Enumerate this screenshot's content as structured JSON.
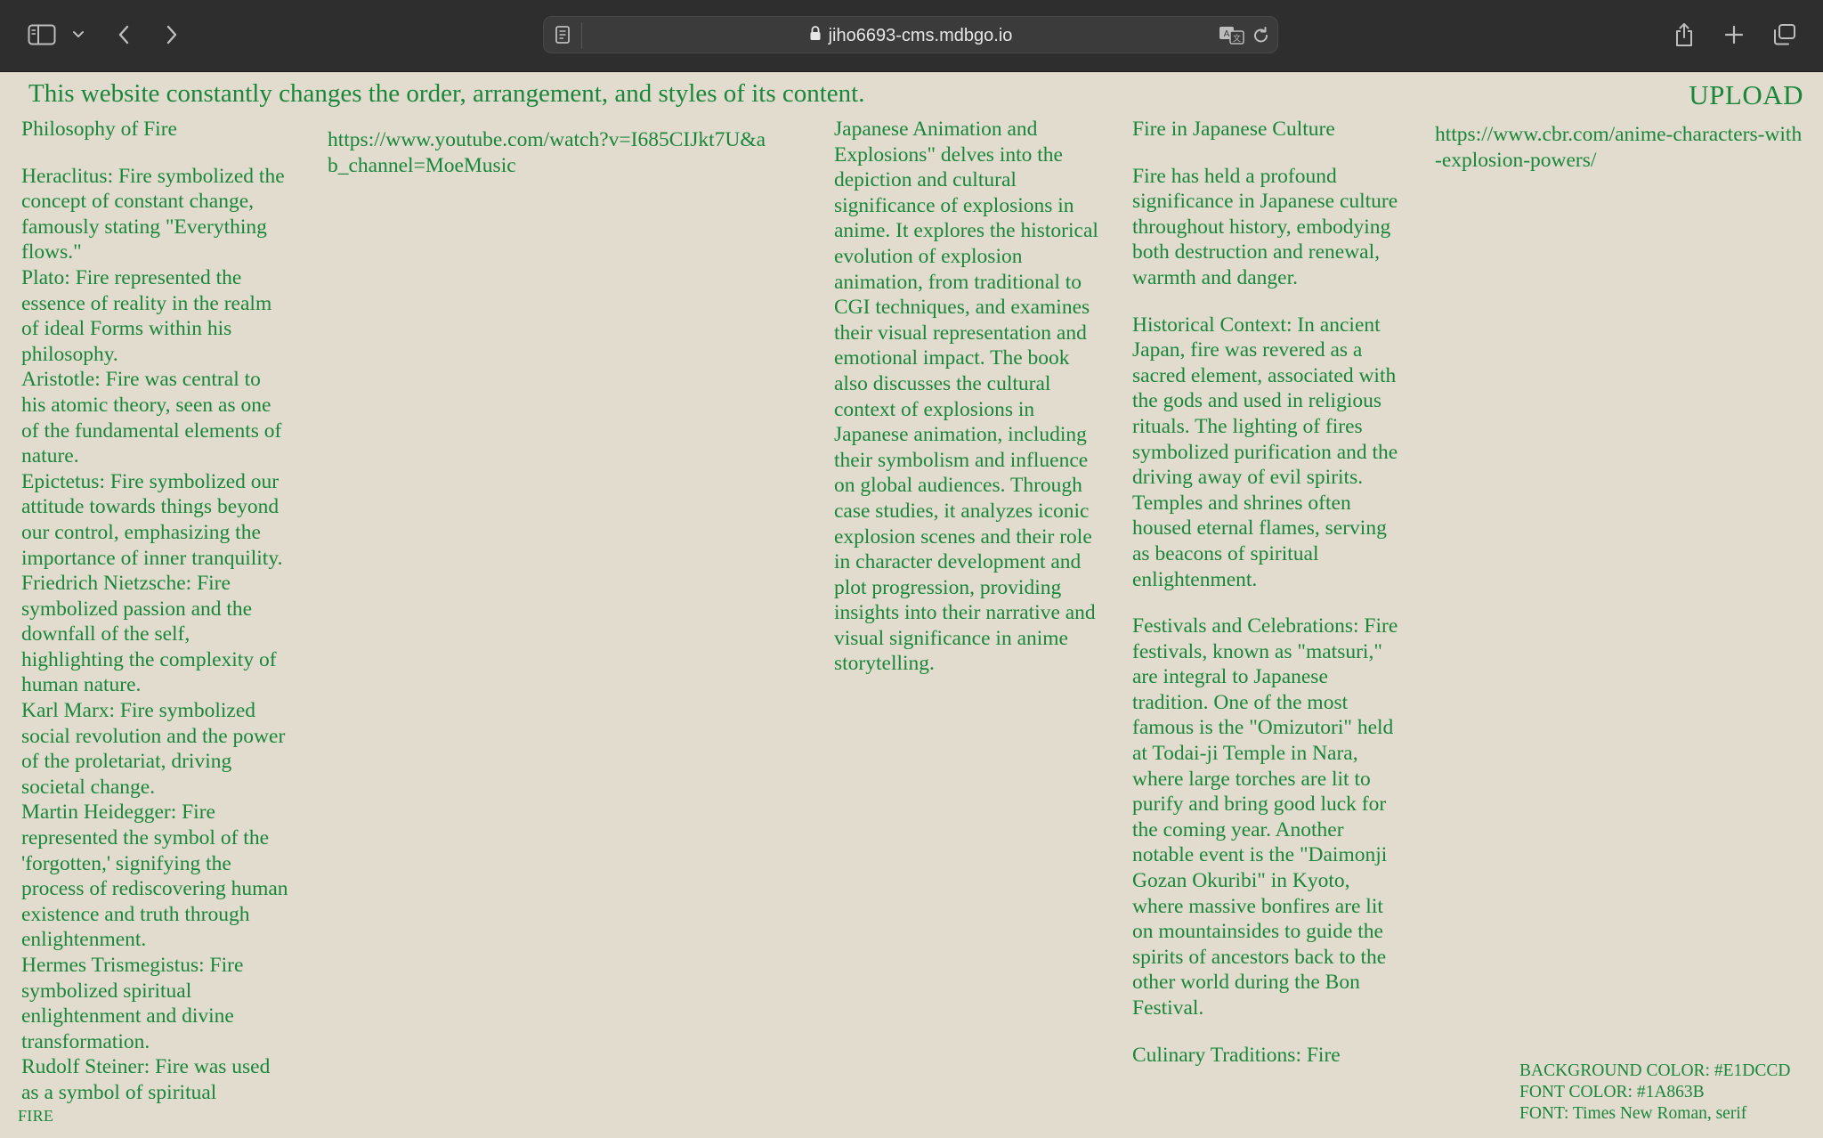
{
  "browser": {
    "url": "jiho6693-cms.mdbgo.io"
  },
  "page": {
    "banner": "This website constantly changes the order, arrangement, and styles of its content.",
    "upload_label": "UPLOAD",
    "colors": {
      "background": "#E1DCCD",
      "text": "#1A863B"
    },
    "philosophy": {
      "title": "Philosophy of Fire",
      "entries": [
        "Heraclitus: Fire symbolized the concept of constant change, famously stating \"Everything flows.\"",
        "Plato: Fire represented the essence of reality in the realm of ideal Forms within his philosophy.",
        "Aristotle: Fire was central to his atomic theory, seen as one of the fundamental elements of nature.",
        "Epictetus: Fire symbolized our attitude towards things beyond our control, emphasizing the importance of inner tranquility.",
        "Friedrich Nietzsche: Fire symbolized passion and the downfall of the self, highlighting the complexity of human nature.",
        "Karl Marx: Fire symbolized social revolution and the power of the proletariat, driving societal change.",
        "Martin Heidegger: Fire represented the symbol of the 'forgotten,' signifying the process of rediscovering human existence and truth through enlightenment.",
        "Hermes Trismegistus: Fire symbolized spiritual enlightenment and divine transformation.",
        "Rudolf Steiner: Fire was used as a symbol of spiritual"
      ]
    },
    "youtube_link": "https://www.youtube.com/watch?v=I685CIJkt7U&ab_channel=MoeMusic",
    "anime_text": "Japanese Animation and Explosions\" delves into the depiction and cultural significance of explosions in anime. It explores the historical evolution of explosion animation, from traditional to CGI techniques, and examines their visual representation and emotional impact. The book also discusses the cultural context of explosions in Japanese animation, including their symbolism and influence on global audiences. Through case studies, it analyzes iconic explosion scenes and their role in character development and plot progression, providing insights into their narrative and visual significance in anime storytelling.",
    "japanese_culture": {
      "title": "Fire in Japanese Culture",
      "paragraphs": [
        "Fire has held a profound significance in Japanese culture throughout history, embodying both destruction and renewal, warmth and danger.",
        "Historical Context: In ancient Japan, fire was revered as a sacred element, associated with the gods and used in religious rituals. The lighting of fires symbolized purification and the driving away of evil spirits. Temples and shrines often housed eternal flames, serving as beacons of spiritual enlightenment.",
        "Festivals and Celebrations: Fire festivals, known as \"matsuri,\" are integral to Japanese tradition. One of the most famous is the \"Omizutori\" held at Todai-ji Temple in Nara, where large torches are lit to purify and bring good luck for the coming year. Another notable event is the \"Daimonji Gozan Okuribi\" in Kyoto, where massive bonfires are lit on mountainsides to guide the spirits of ancestors back to the other world during the Bon Festival.",
        "Culinary Traditions: Fire"
      ]
    },
    "cbr_link": "https://www.cbr.com/anime-characters-with-explosion-powers/",
    "style_info": [
      "BACKGROUND COLOR: #E1DCCD",
      "FONT COLOR: #1A863B",
      "FONT: Times New Roman, serif"
    ],
    "fire_tag": "FIRE"
  }
}
